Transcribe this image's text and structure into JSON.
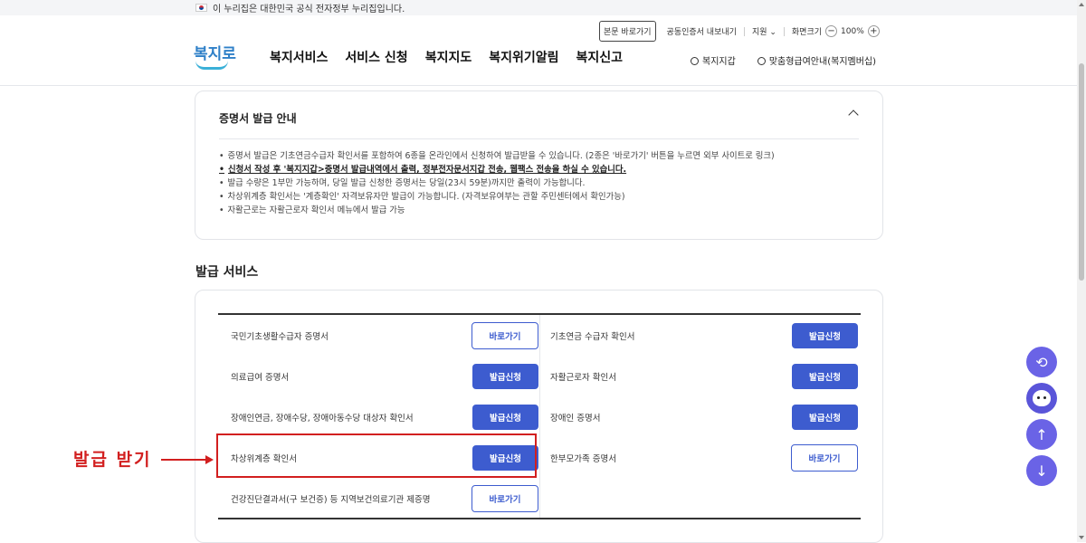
{
  "gov_banner": {
    "text": "이 누리집은 대한민국 공식 전자정부 누리집입니다."
  },
  "header": {
    "logo_text": "복지로",
    "skip_label": "본문 바로가기",
    "cert_label": "공동인증서 내보내기",
    "support_label": "지원",
    "zoom_label": "화면크기",
    "zoom_value": "100%",
    "zoom_minus": "−",
    "zoom_plus": "+",
    "nav": [
      "복지서비스",
      "서비스 신청",
      "복지지도",
      "복지위기알림",
      "복지신고"
    ],
    "wallet_label": "복지지갑",
    "custom_label": "맞춤형급여안내(복지멤버십)"
  },
  "guide": {
    "title": "증명서 발급 안내",
    "items": [
      "증명서 발급은 기초연금수급자 확인서를 포함하여 6종을 온라인에서 신청하여 발급받을 수 있습니다. (2종은 '바로가기' 버튼을 누르면 외부 사이트로 링크)",
      "신청서 작성 후 '복지지갑>증명서 발급내역에서 출력, 정부전자문서지갑 전송, 웹팩스 전송을 하실 수 있습니다.",
      "발급 수량은 1부만 가능하며, 당일 발급 신청한 증명서는 당일(23시 59분)까지만 출력이 가능합니다.",
      "차상위계층 확인서는 '계층확인' 자격보유자만 발급이 가능합니다. (자격보유여부는 관할 주민센터에서 확인가능)",
      "자활근로는 자활근로자 확인서 메뉴에서 발급 가능"
    ]
  },
  "section": {
    "title": "발급 서비스"
  },
  "services_left": [
    {
      "label": "국민기초생활수급자 증명서",
      "button": "바로가기",
      "kind": "go"
    },
    {
      "label": "의료급여 증명서",
      "button": "발급신청",
      "kind": "apply"
    },
    {
      "label": "장애인연금, 장애수당, 장애아동수당 대상자 확인서",
      "button": "발급신청",
      "kind": "apply"
    },
    {
      "label": "차상위계층 확인서",
      "button": "발급신청",
      "kind": "apply"
    },
    {
      "label": "건강진단결과서(구 보건증) 등 지역보건의료기관 제증명",
      "button": "바로가기",
      "kind": "go"
    }
  ],
  "services_right": [
    {
      "label": "기초연금 수급자 확인서",
      "button": "발급신청",
      "kind": "apply"
    },
    {
      "label": "자활근로자 확인서",
      "button": "발급신청",
      "kind": "apply"
    },
    {
      "label": "장애인 증명서",
      "button": "발급신청",
      "kind": "apply"
    },
    {
      "label": "한부모가족 증명서",
      "button": "바로가기",
      "kind": "go"
    }
  ],
  "annotation": {
    "text": "발급 받기",
    "color": "#d21f1f"
  },
  "colors": {
    "primary": "#3d5ccf",
    "floating": "#6a63e6"
  },
  "floating": {
    "icons": [
      "history-icon",
      "mascot-icon",
      "arrow-up-icon",
      "arrow-down-icon"
    ]
  }
}
